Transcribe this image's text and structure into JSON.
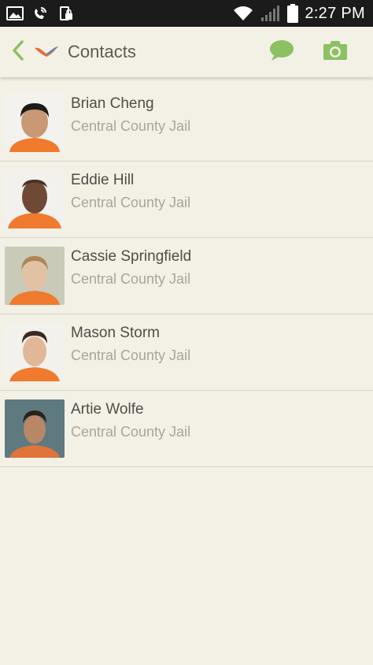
{
  "status_bar": {
    "time": "2:27 PM",
    "icons": [
      "image-icon",
      "phone-wifi-icon",
      "lock-icon",
      "wifi-icon",
      "signal-icon",
      "battery-icon"
    ]
  },
  "app_bar": {
    "title": "Contacts",
    "back_icon": "chevron-left-icon",
    "logo": "app-logo-icon",
    "actions": [
      "message-icon",
      "camera-icon"
    ]
  },
  "colors": {
    "accent_green": "#8cc063",
    "background": "#f3f0e6",
    "logo_orange": "#e86a3a",
    "logo_blue": "#4a90c8"
  },
  "contacts": [
    {
      "name": "Brian Cheng",
      "facility": "Central County Jail"
    },
    {
      "name": "Eddie Hill",
      "facility": "Central County Jail"
    },
    {
      "name": "Cassie Springfield",
      "facility": "Central County Jail"
    },
    {
      "name": "Mason Storm",
      "facility": "Central County Jail"
    },
    {
      "name": "Artie Wolfe",
      "facility": "Central County Jail"
    }
  ]
}
